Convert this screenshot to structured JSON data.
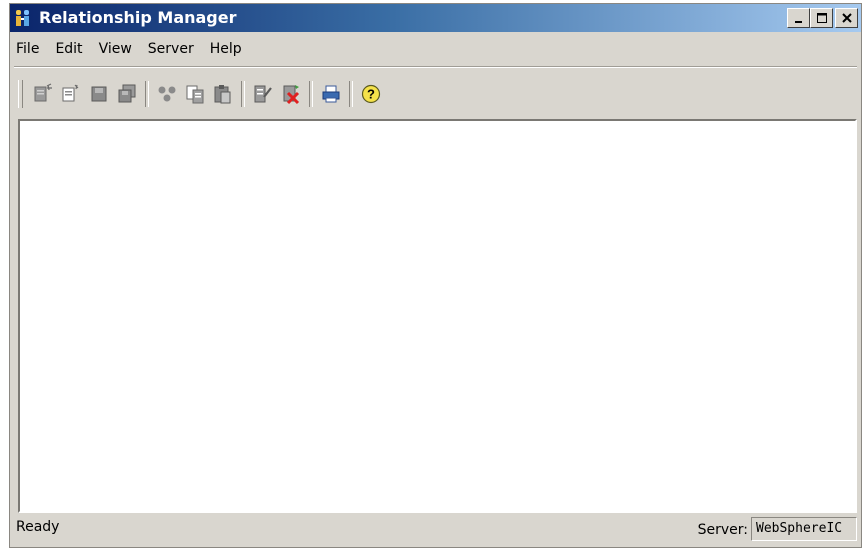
{
  "window": {
    "title": "Relationship Manager",
    "controls": {
      "minimize_icon": "minimize-icon",
      "maximize_icon": "maximize-icon",
      "close_icon": "close-icon"
    }
  },
  "menu": {
    "items": [
      {
        "label": "File"
      },
      {
        "label": "Edit"
      },
      {
        "label": "View"
      },
      {
        "label": "Server"
      },
      {
        "label": "Help"
      }
    ]
  },
  "toolbar": {
    "buttons": [
      "new-relationship-icon",
      "new-participant-icon",
      "save-icon",
      "save-all-icon",
      "cut-icon",
      "copy-icon",
      "paste-icon",
      "edit-properties-icon",
      "delete-icon",
      "print-icon",
      "help-icon"
    ]
  },
  "status": {
    "text": "Ready",
    "server_label": "Server:",
    "server_value": "WebSphereIC"
  },
  "colors": {
    "title_start": "#0a246a",
    "title_end": "#a6caf0",
    "chrome": "#d9d6cf"
  }
}
